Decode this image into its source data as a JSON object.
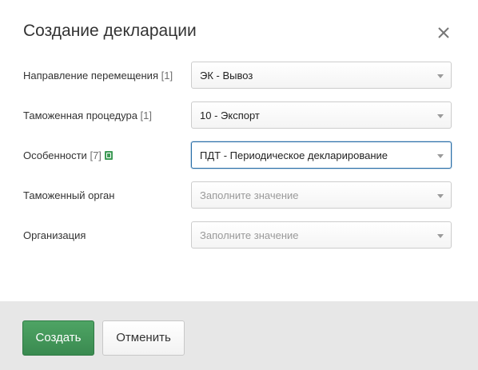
{
  "dialog": {
    "title": "Создание декларации",
    "close_icon": "close-icon"
  },
  "fields": [
    {
      "label": "Направление перемещения",
      "count": "[1]",
      "value": "ЭК - Вывоз",
      "is_placeholder": false
    },
    {
      "label": "Таможенная процедура",
      "count": "[1]",
      "value": "10 - Экспорт",
      "is_placeholder": false
    },
    {
      "label": "Особенности",
      "count": "[7]",
      "value": "ПДТ - Периодическое декларирование",
      "is_placeholder": false,
      "focused": true,
      "icon": "help-icon"
    },
    {
      "label": "Таможенный орган",
      "count": "",
      "value": "Заполните значение",
      "is_placeholder": true
    },
    {
      "label": "Организация",
      "count": "",
      "value": "Заполните значение",
      "is_placeholder": true
    }
  ],
  "footer": {
    "create_label": "Создать",
    "cancel_label": "Отменить"
  },
  "colors": {
    "primary": "#3f9b57",
    "focus_border": "#2a6fa8",
    "footer_bg": "#e7e7e7"
  }
}
